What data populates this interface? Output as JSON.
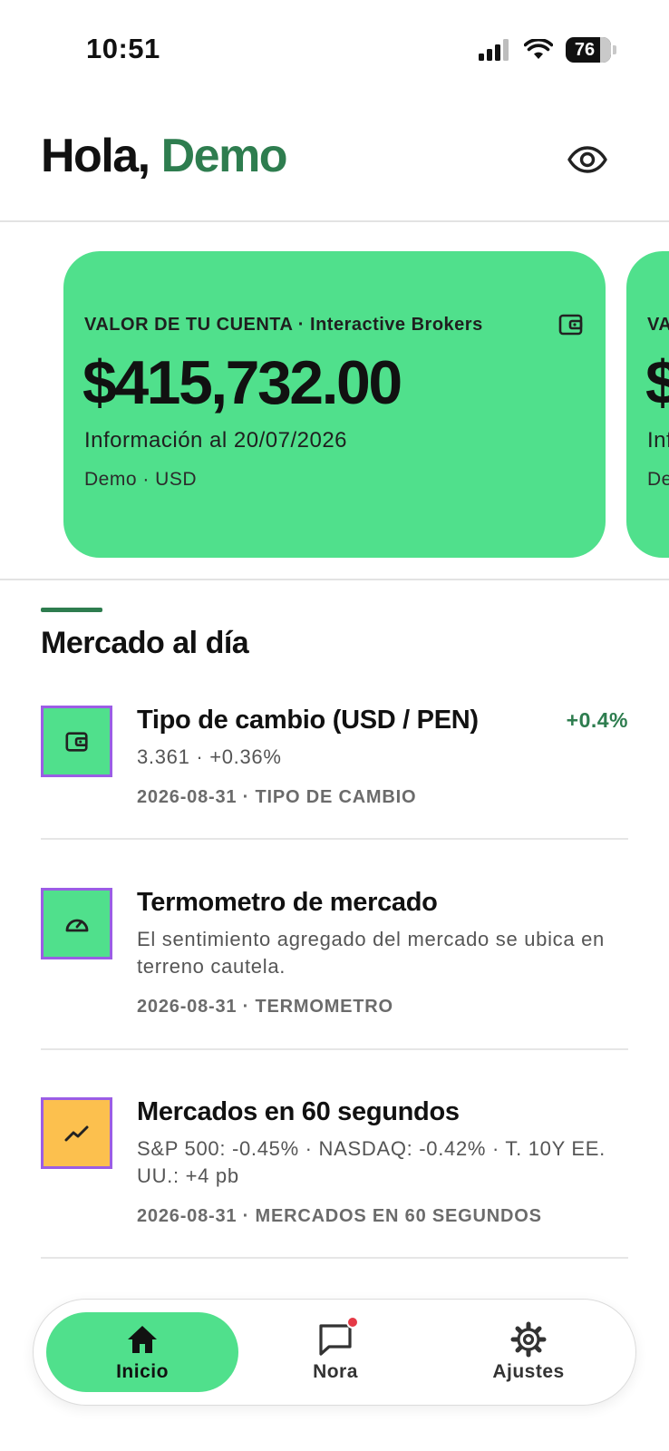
{
  "status_bar": {
    "time": "10:51",
    "battery": "76",
    "icons": [
      "signal-icon",
      "wifi-icon",
      "battery-icon"
    ]
  },
  "header": {
    "greeting_prefix": "Hola,",
    "greeting_name": "Demo",
    "toggle_icon": "eye-icon"
  },
  "colors": {
    "accent_green": "#50e08c",
    "dark_green": "#2e7d4f",
    "orange": "#fcc04e",
    "icon_border": "#9b5de5",
    "notification": "#e53946"
  },
  "account_cards": [
    {
      "label": "VALOR DE TU CUENTA · Interactive Brokers",
      "value": "$415,732.00",
      "info": "Información al 20/07/2026",
      "sub": "Demo · USD",
      "icon": "wallet-icon"
    },
    {
      "label": "VA",
      "value": "$",
      "info": "Inf",
      "sub": "De"
    }
  ],
  "market": {
    "title": "Mercado al día",
    "items": [
      {
        "icon": "wallet-icon",
        "title": "Tipo de cambio (USD / PEN)",
        "change": "+0.4%",
        "body": "3.361 · +0.36%",
        "meta": "2026-08-31 · TIPO DE CAMBIO"
      },
      {
        "icon": "gauge-icon",
        "title": "Termometro de mercado",
        "body": "El sentimiento agregado del mercado se ubica en terreno cautela.",
        "meta": "2026-08-31 · TERMOMETRO"
      },
      {
        "icon": "trend-icon",
        "title": "Mercados en 60 segundos",
        "body": "S&P 500: -0.45% · NASDAQ: -0.42% · T. 10Y EE. UU.: +4 pb",
        "meta": "2026-08-31 · MERCADOS EN 60 SEGUNDOS"
      }
    ]
  },
  "nav": {
    "items": [
      {
        "label": "Inicio",
        "icon": "home-icon",
        "active": true
      },
      {
        "label": "Nora",
        "icon": "chat-icon",
        "badge": true
      },
      {
        "label": "Ajustes",
        "icon": "gear-icon"
      }
    ]
  }
}
